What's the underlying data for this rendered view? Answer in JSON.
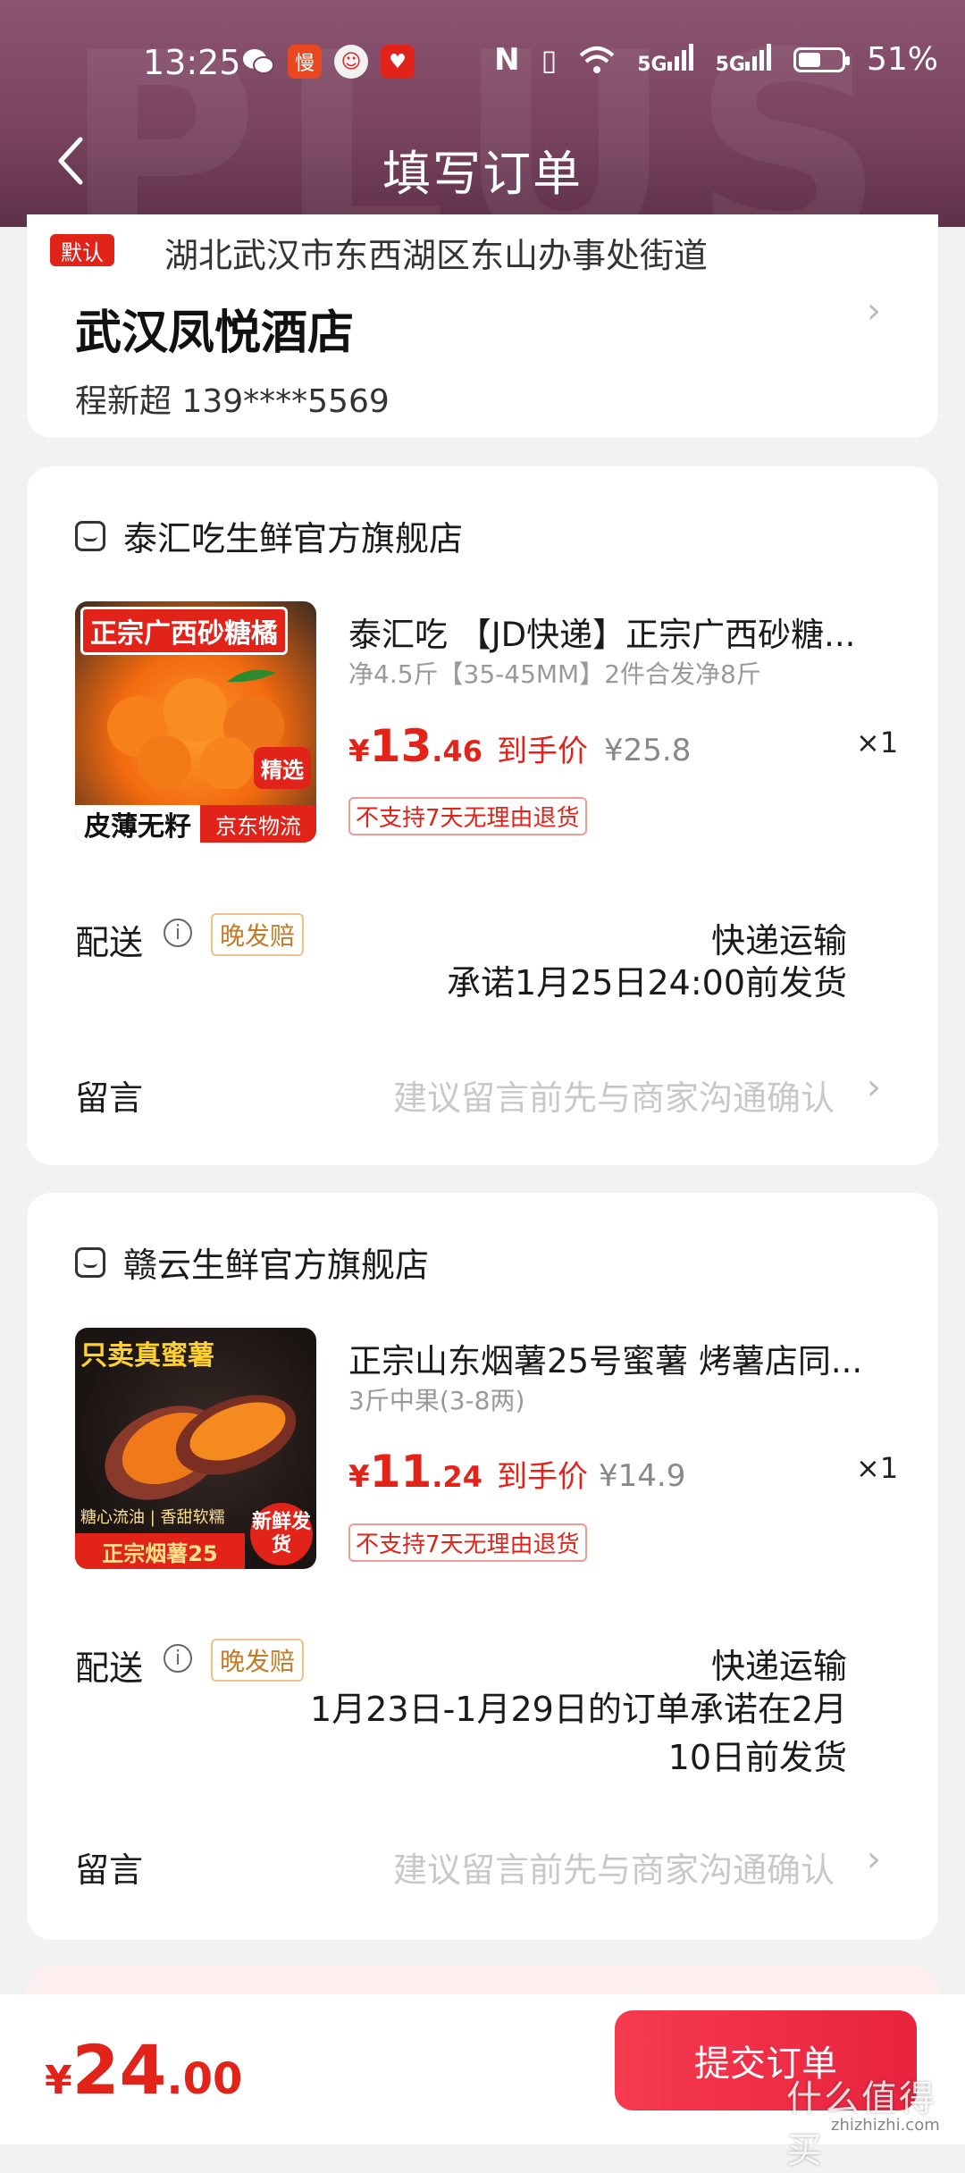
{
  "status_bar": {
    "time": "13:25",
    "battery": "51%",
    "network": "5G",
    "app_icons": [
      "wechat-icon",
      "app-red-icon",
      "app-mascot-icon",
      "app-red-heart-icon"
    ]
  },
  "header": {
    "title": "填写订单",
    "watermark": "PLUS"
  },
  "address": {
    "default_tag": "默认",
    "line": "湖北武汉市东西湖区东山办事处街道",
    "name": "武汉凤悦酒店",
    "contact": "程新超  139****5569"
  },
  "shops": [
    {
      "name": "泰汇吃生鲜官方旗舰店",
      "thumb_banner": "正宗广西砂糖橘",
      "thumb_bottom_left": "皮薄无籽",
      "thumb_bottom_right": "京东物流",
      "thumb_badge": "精选",
      "product_title": "泰汇吃 【JD快递】正宗广西砂糖...",
      "spec": "净4.5斤【35-45MM】2件合发净8斤",
      "price_symbol": "¥",
      "price_int": "13",
      "price_dec": ".46",
      "price_label": "到手价",
      "old_price": "¥25.8",
      "qty": "×1",
      "no_return": "不支持7天无理由退货",
      "delivery_label": "配送",
      "late_badge": "晚发赔",
      "ship_method": "快递运输",
      "ship_promise": "承诺1月25日24:00前发货",
      "message_label": "留言",
      "message_placeholder": "建议留言前先与商家沟通确认"
    },
    {
      "name": "赣云生鲜官方旗舰店",
      "thumb_banner": "只卖真蜜薯",
      "thumb_bottom_left": "正宗烟薯25",
      "thumb_bottom_right": "新鲜发货",
      "thumb_sub": "糖心流油 | 香甜软糯",
      "product_title": "正宗山东烟薯25号蜜薯 烤薯店同...",
      "spec": "3斤中果(3-8两)",
      "price_symbol": "¥",
      "price_int": "11",
      "price_dec": ".24",
      "price_label": "到手价",
      "old_price": "¥14.9",
      "qty": "×1",
      "no_return": "不支持7天无理由退货",
      "delivery_label": "配送",
      "late_badge": "晚发赔",
      "ship_method": "快递运输",
      "ship_promise_line1": "1月23日-1月29日的订单承诺在2月",
      "ship_promise_line2": "10日前发货",
      "message_label": "留言",
      "message_placeholder": "建议留言前先与商家沟通确认"
    }
  ],
  "footer": {
    "total_symbol": "¥",
    "total_int": "24",
    "total_dec": ".00",
    "submit_label": "提交订单",
    "site_watermark": "什么值得买",
    "site_url": "zhizhizhi.com"
  }
}
